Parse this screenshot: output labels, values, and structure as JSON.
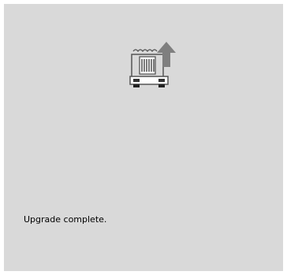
{
  "screen": {
    "background": "#d9d9d9"
  },
  "upgrade_icon": {
    "name": "machine-upgrade-icon",
    "arrow_color": "#7f7f7f"
  },
  "status": {
    "message": "Upgrade complete."
  }
}
